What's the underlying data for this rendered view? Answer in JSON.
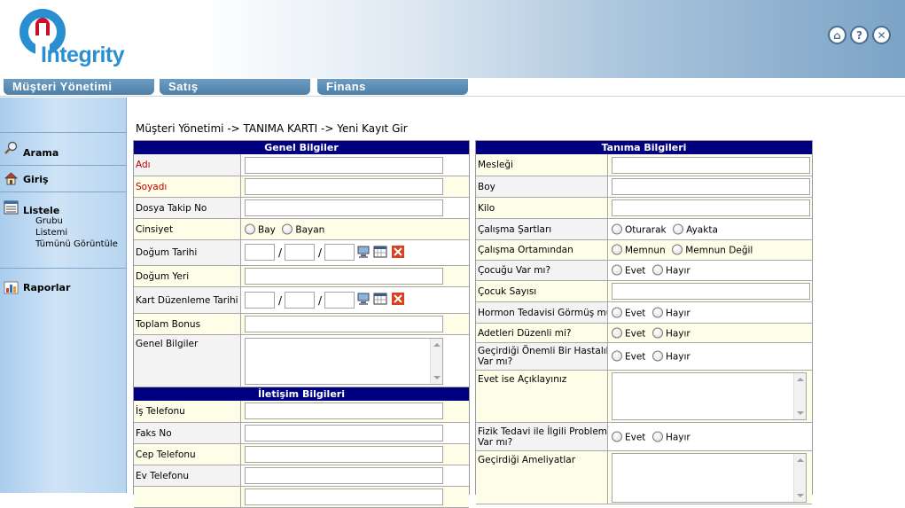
{
  "brand": {
    "logo_text": "Integrity"
  },
  "tabs": [
    {
      "label": "Müşteri Yönetimi"
    },
    {
      "label": "Satış"
    },
    {
      "label": "Finans"
    }
  ],
  "sidebar": {
    "items": [
      {
        "label": "Arama",
        "icon": "search-icon"
      },
      {
        "label": "Giriş",
        "icon": "house-icon"
      },
      {
        "label": "Listele",
        "icon": "list-icon",
        "subitems": [
          "Grubu",
          "Listemi",
          "Tümünü Görüntüle"
        ]
      },
      {
        "label": "Raporlar",
        "icon": "chart-icon"
      }
    ]
  },
  "breadcrumb": "Müşteri Yönetimi -> TANIMA KARTI -> Yeni Kayıt Gir",
  "left": {
    "genel_header": "Genel Bilgiler",
    "adi": "Adı",
    "soyadi": "Soyadı",
    "dosya_takip": "Dosya Takip No",
    "cinsiyet": "Cinsiyet",
    "cinsiyet_opts": [
      "Bay",
      "Bayan"
    ],
    "dogum_tarihi": "Doğum Tarihi",
    "dogum_yeri": "Doğum Yeri",
    "kart_tarihi": "Kart Düzenleme Tarihi",
    "toplam_bonus": "Toplam Bonus",
    "genel_bilgiler": "Genel Bilgiler",
    "iletisim_header": "İletişim Bilgileri",
    "is_tel": "İş Telefonu",
    "faks": "Faks No",
    "cep_tel": "Cep Telefonu",
    "ev_tel": "Ev Telefonu",
    "date_sep": "/"
  },
  "right": {
    "header": "Tanıma Bilgileri",
    "meslegi": "Mesleği",
    "boy": "Boy",
    "kilo": "Kilo",
    "calisma_sartlari": "Çalışma Şartları",
    "calisma_sartlari_opts": [
      "Oturarak",
      "Ayakta"
    ],
    "calisma_ortami": "Çalışma Ortamından",
    "calisma_ortami_opts": [
      "Memnun",
      "Memnun Değil"
    ],
    "cocugu": "Çocuğu Var mı?",
    "cocuk_sayisi": "Çocuk Sayısı",
    "hormon": "Hormon Tedavisi Görmüş mü?",
    "adetleri": "Adetleri Düzenli mi?",
    "hastalik_1": "Geçirdiği Önemli Bir Hastalık",
    "hastalik_2": "Var mı?",
    "evet_ise": "Evet ise Açıklayınız",
    "fizik_1": "Fizik Tedavi ile İlgili Problemi",
    "fizik_2": "Var mı?",
    "ameliyat": "Geçirdiği Ameliyatlar",
    "yes": "Evet",
    "no": "Hayır"
  }
}
